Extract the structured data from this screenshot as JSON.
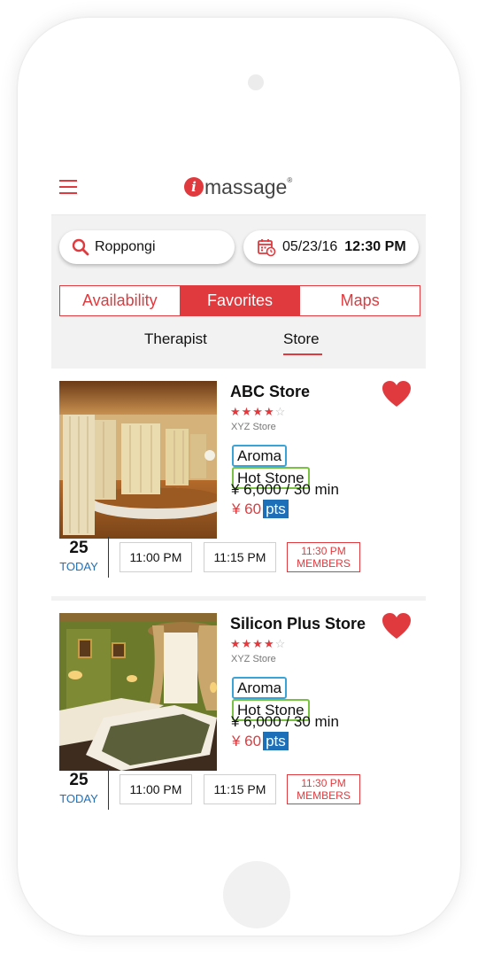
{
  "header": {
    "logo_text": "massage",
    "logo_i": "i",
    "logo_reg": "®",
    "menu_icon": "hamburger-menu-icon"
  },
  "search": {
    "location_value": "Roppongi",
    "date": "05/23/16",
    "time": "12:30 PM"
  },
  "tabs": [
    {
      "label": "Availability",
      "active": false
    },
    {
      "label": "Favorites",
      "active": true
    },
    {
      "label": "Maps",
      "active": false
    }
  ],
  "subtabs": [
    {
      "label": "Therapist",
      "active": false
    },
    {
      "label": "Store",
      "active": true
    }
  ],
  "colors": {
    "accent": "#e03a3e",
    "blue": "#1d6fb8",
    "aroma_border": "#3aa3d8",
    "hotstone_border": "#79c143"
  },
  "stores": [
    {
      "name": "ABC Store",
      "rating": 4,
      "rating_max": 5,
      "sub": "XYZ Store",
      "tags": [
        "Aroma",
        "Hot Stone"
      ],
      "price": "¥ 6,000 / 30 min",
      "points": "¥ 60",
      "points_unit": "pts",
      "favorite": true,
      "day": "25",
      "day_label": "TODAY",
      "slots": [
        "11:00 PM",
        "11:15 PM"
      ],
      "members_slot": {
        "time": "11:30 PM",
        "label": "MEMBERS"
      }
    },
    {
      "name": "Silicon Plus Store",
      "rating": 4,
      "rating_max": 5,
      "sub": "XYZ Store",
      "tags": [
        "Aroma",
        "Hot Stone"
      ],
      "price": "¥ 6,000 / 30 min",
      "points": "¥ 60",
      "points_unit": "pts",
      "favorite": true,
      "day": "25",
      "day_label": "TODAY",
      "slots": [
        "11:00 PM",
        "11:15 PM"
      ],
      "members_slot": {
        "time": "11:30 PM",
        "label": "MEMBERS"
      }
    }
  ]
}
